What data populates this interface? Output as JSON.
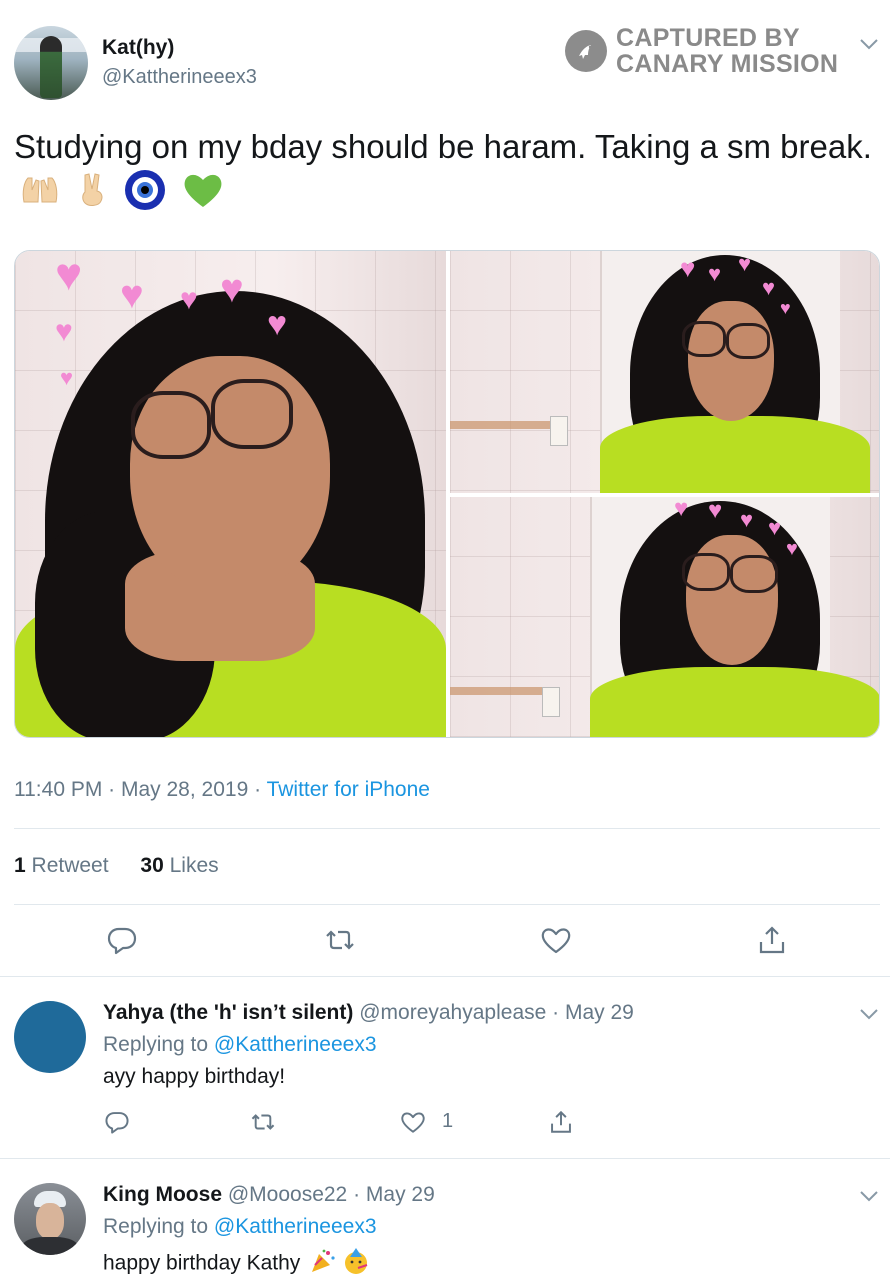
{
  "tweet": {
    "display_name": "Kat(hy)",
    "handle": "@Kattherineeex3",
    "text": "Studying on my bday should be haram. Taking a sm break.",
    "emojis": [
      "raised-hands-emoji",
      "victory-hand-emoji",
      "evil-eye-emoji",
      "green-heart-emoji"
    ],
    "time": "11:40 PM",
    "date": "May 28, 2019",
    "source": "Twitter for iPhone",
    "retweets_count": "1",
    "retweets_label": "Retweet",
    "likes_count": "30",
    "likes_label": "Likes"
  },
  "watermark": {
    "line1": "CAPTURED BY",
    "line2": "CANARY MISSION"
  },
  "replies": [
    {
      "display_name": "Yahya (the 'h' isn’t silent)",
      "handle": "@moreyahyaplease",
      "date": "May 29",
      "replying_label": "Replying to",
      "replying_to": "@Kattherineeex3",
      "text": "ayy happy birthday!",
      "like_count": "1",
      "avatar_color": "#1f6a9a"
    },
    {
      "display_name": "King Moose",
      "handle": "@Mooose22",
      "date": "May 29",
      "replying_label": "Replying to",
      "replying_to": "@Kattherineeex3",
      "text": "happy birthday Kathy",
      "emojis": [
        "party-popper-emoji",
        "partying-face-emoji"
      ]
    }
  ],
  "colors": {
    "link": "#1b95e0",
    "muted": "#657786",
    "text": "#14171a",
    "shirt": "#b8de22"
  }
}
